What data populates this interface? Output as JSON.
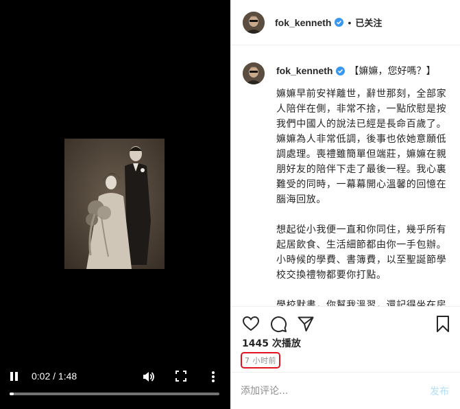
{
  "player": {
    "time": "0:02 / 1:48",
    "progress": 0.02,
    "icons": [
      "pause-icon",
      "volume-icon",
      "fullscreen-icon",
      "more-vertical-icon"
    ]
  },
  "post": {
    "username": "fok_kenneth",
    "header_dot": "•",
    "follow_status": "已关注",
    "caption": {
      "title": "【嫲嫲，您好嗎？】",
      "paragraphs": [
        "嫲嫲早前安祥離世，辭世那刻，全部家人陪伴在側，非常不捨，一點欣慰是按我們中國人的說法已經是長命百歲了。嫲嫲為人非常低調，後事也依她意願低調處理。喪禮雖簡單但端莊，嫲嫲在親朋好友的陪伴下走了最後一程。我心裏難受的同時，一幕幕開心溫馨的回憶在腦海回放。",
        "想起從小我便一直和你同住，幾乎所有起居飲食、生活細節都由你一手包辦。小時候的學費、書簿費，以至聖誕節學校交換禮物都要你打點。",
        "學校默書，你幫我溫習，還記得坐在房門口，你教我「耳王十四一心」加在一起就是個「聽」字。那時家中我年紀最小，吃飯時你總是把雞髀留給我，上學"
      ]
    },
    "views": "1445 次播放",
    "timestamp": "7 小时前",
    "comment_placeholder": "添加评论...",
    "post_label": "发布",
    "colors": {
      "verified": "#3897f0",
      "highlight": "#e0141e",
      "post_disabled": "#b2dffc"
    }
  }
}
